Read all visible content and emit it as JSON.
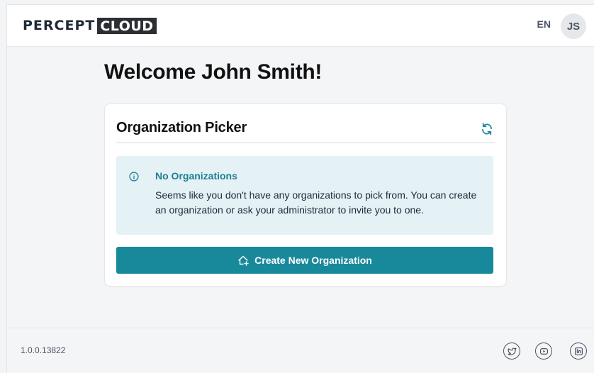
{
  "header": {
    "logo_word": "PERCEPT",
    "logo_box": "CLOUD",
    "language": "EN",
    "avatar_initials": "JS"
  },
  "main": {
    "welcome": "Welcome John Smith!",
    "card": {
      "title": "Organization Picker",
      "refresh_icon": "refresh-icon",
      "alert": {
        "icon": "info-icon",
        "title": "No Organizations",
        "body": "Seems like you don't have any organizations to pick from. You can create an organization or ask your administrator to invite you to one."
      },
      "create_button": {
        "icon": "add-home-icon",
        "label": "Create New Organization"
      }
    }
  },
  "footer": {
    "version": "1.0.0.13822",
    "social": [
      "twitter-icon",
      "youtube-icon",
      "linkedin-icon"
    ]
  },
  "colors": {
    "accent": "#18899b",
    "alert_bg": "#e4f1f5",
    "alert_title": "#1d7f93",
    "page_bg": "#f4f5f7"
  }
}
